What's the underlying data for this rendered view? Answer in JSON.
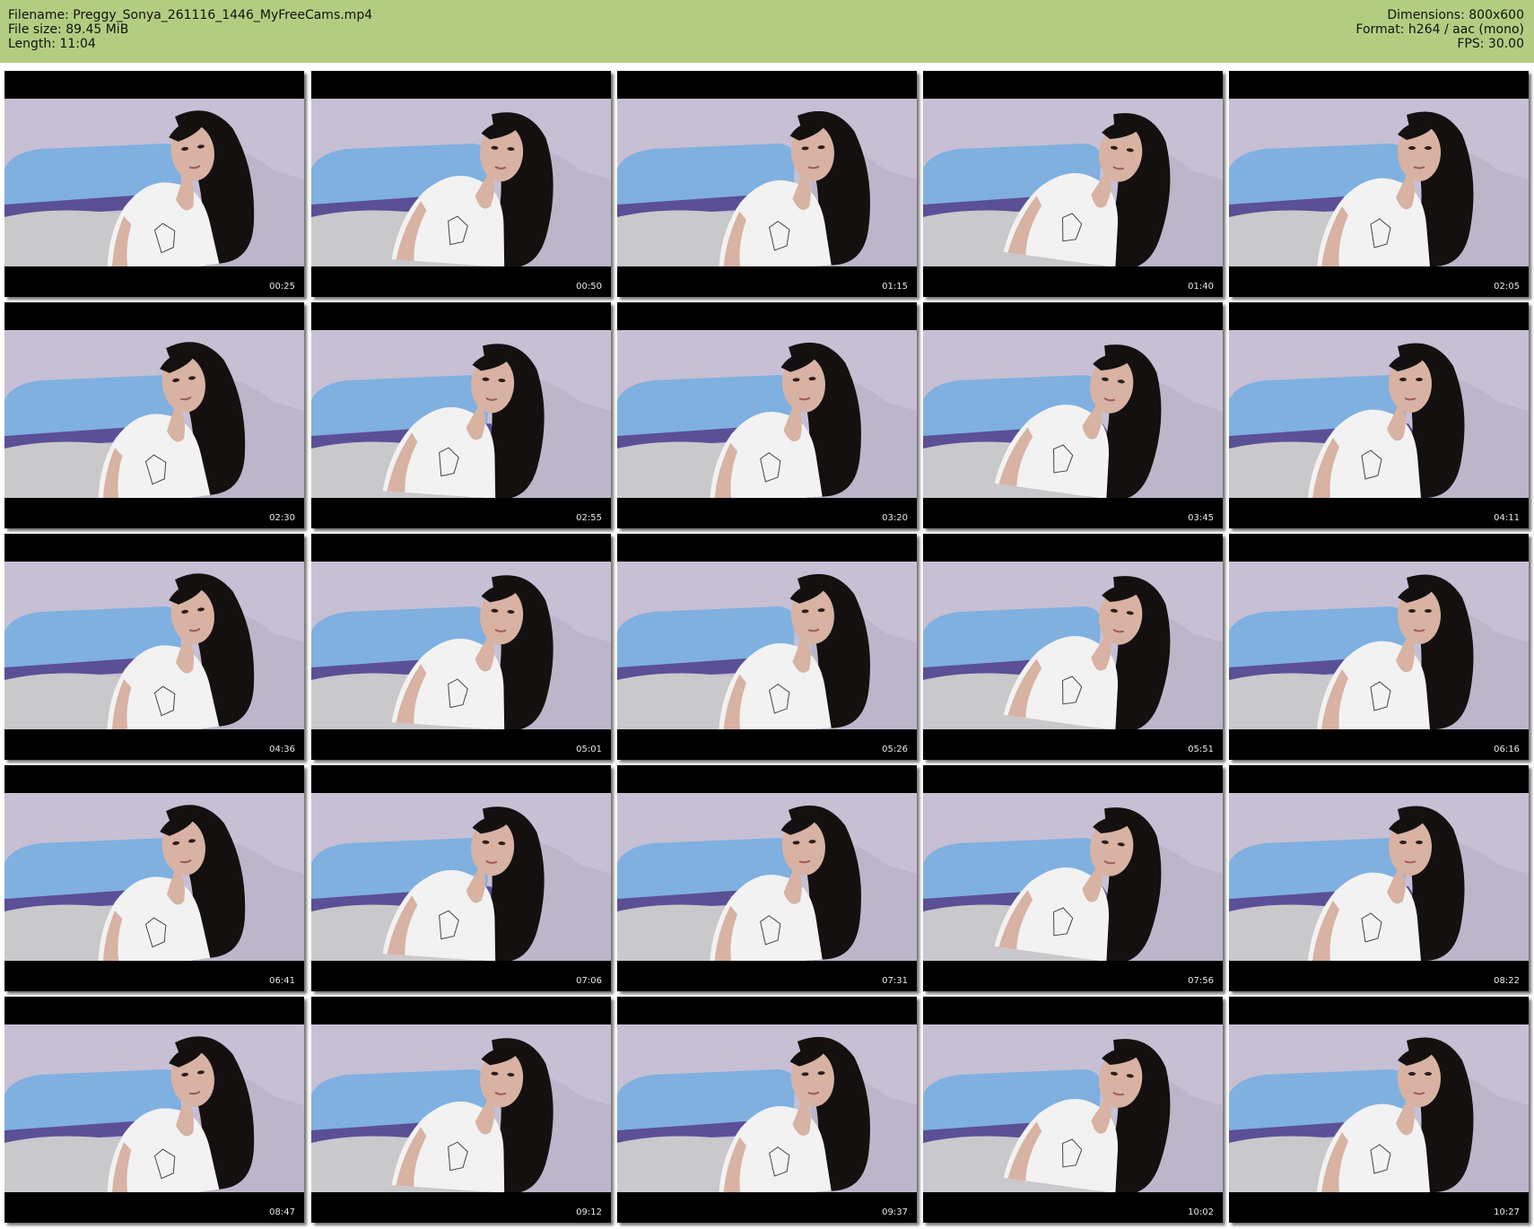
{
  "header": {
    "left": [
      "Filename: Preggy_Sonya_261116_1446_MyFreeCams.mp4",
      "File size: 89.45 MiB",
      "Length: 11:04"
    ],
    "right": [
      "Dimensions: 800x600",
      "Format: h264 / aac (mono)",
      "FPS: 30.00"
    ]
  },
  "colors": {
    "header_bg": "#b2cd81",
    "wall": "#c7bfd4",
    "pillow": "#7fb0e0",
    "sofa": "#c9c9cc",
    "purple_sheet": "#5b4f96",
    "hair": "#141010",
    "skin": "#d8b2a2",
    "top": "#f2f2f2"
  },
  "thumbnails": [
    {
      "time": "00:25"
    },
    {
      "time": "00:50"
    },
    {
      "time": "01:15"
    },
    {
      "time": "01:40"
    },
    {
      "time": "02:05"
    },
    {
      "time": "02:30"
    },
    {
      "time": "02:55"
    },
    {
      "time": "03:20"
    },
    {
      "time": "03:45"
    },
    {
      "time": "04:11"
    },
    {
      "time": "04:36"
    },
    {
      "time": "05:01"
    },
    {
      "time": "05:26"
    },
    {
      "time": "05:51"
    },
    {
      "time": "06:16"
    },
    {
      "time": "06:41"
    },
    {
      "time": "07:06"
    },
    {
      "time": "07:31"
    },
    {
      "time": "07:56"
    },
    {
      "time": "08:22"
    },
    {
      "time": "08:47"
    },
    {
      "time": "09:12"
    },
    {
      "time": "09:37"
    },
    {
      "time": "10:02"
    },
    {
      "time": "10:27"
    }
  ]
}
